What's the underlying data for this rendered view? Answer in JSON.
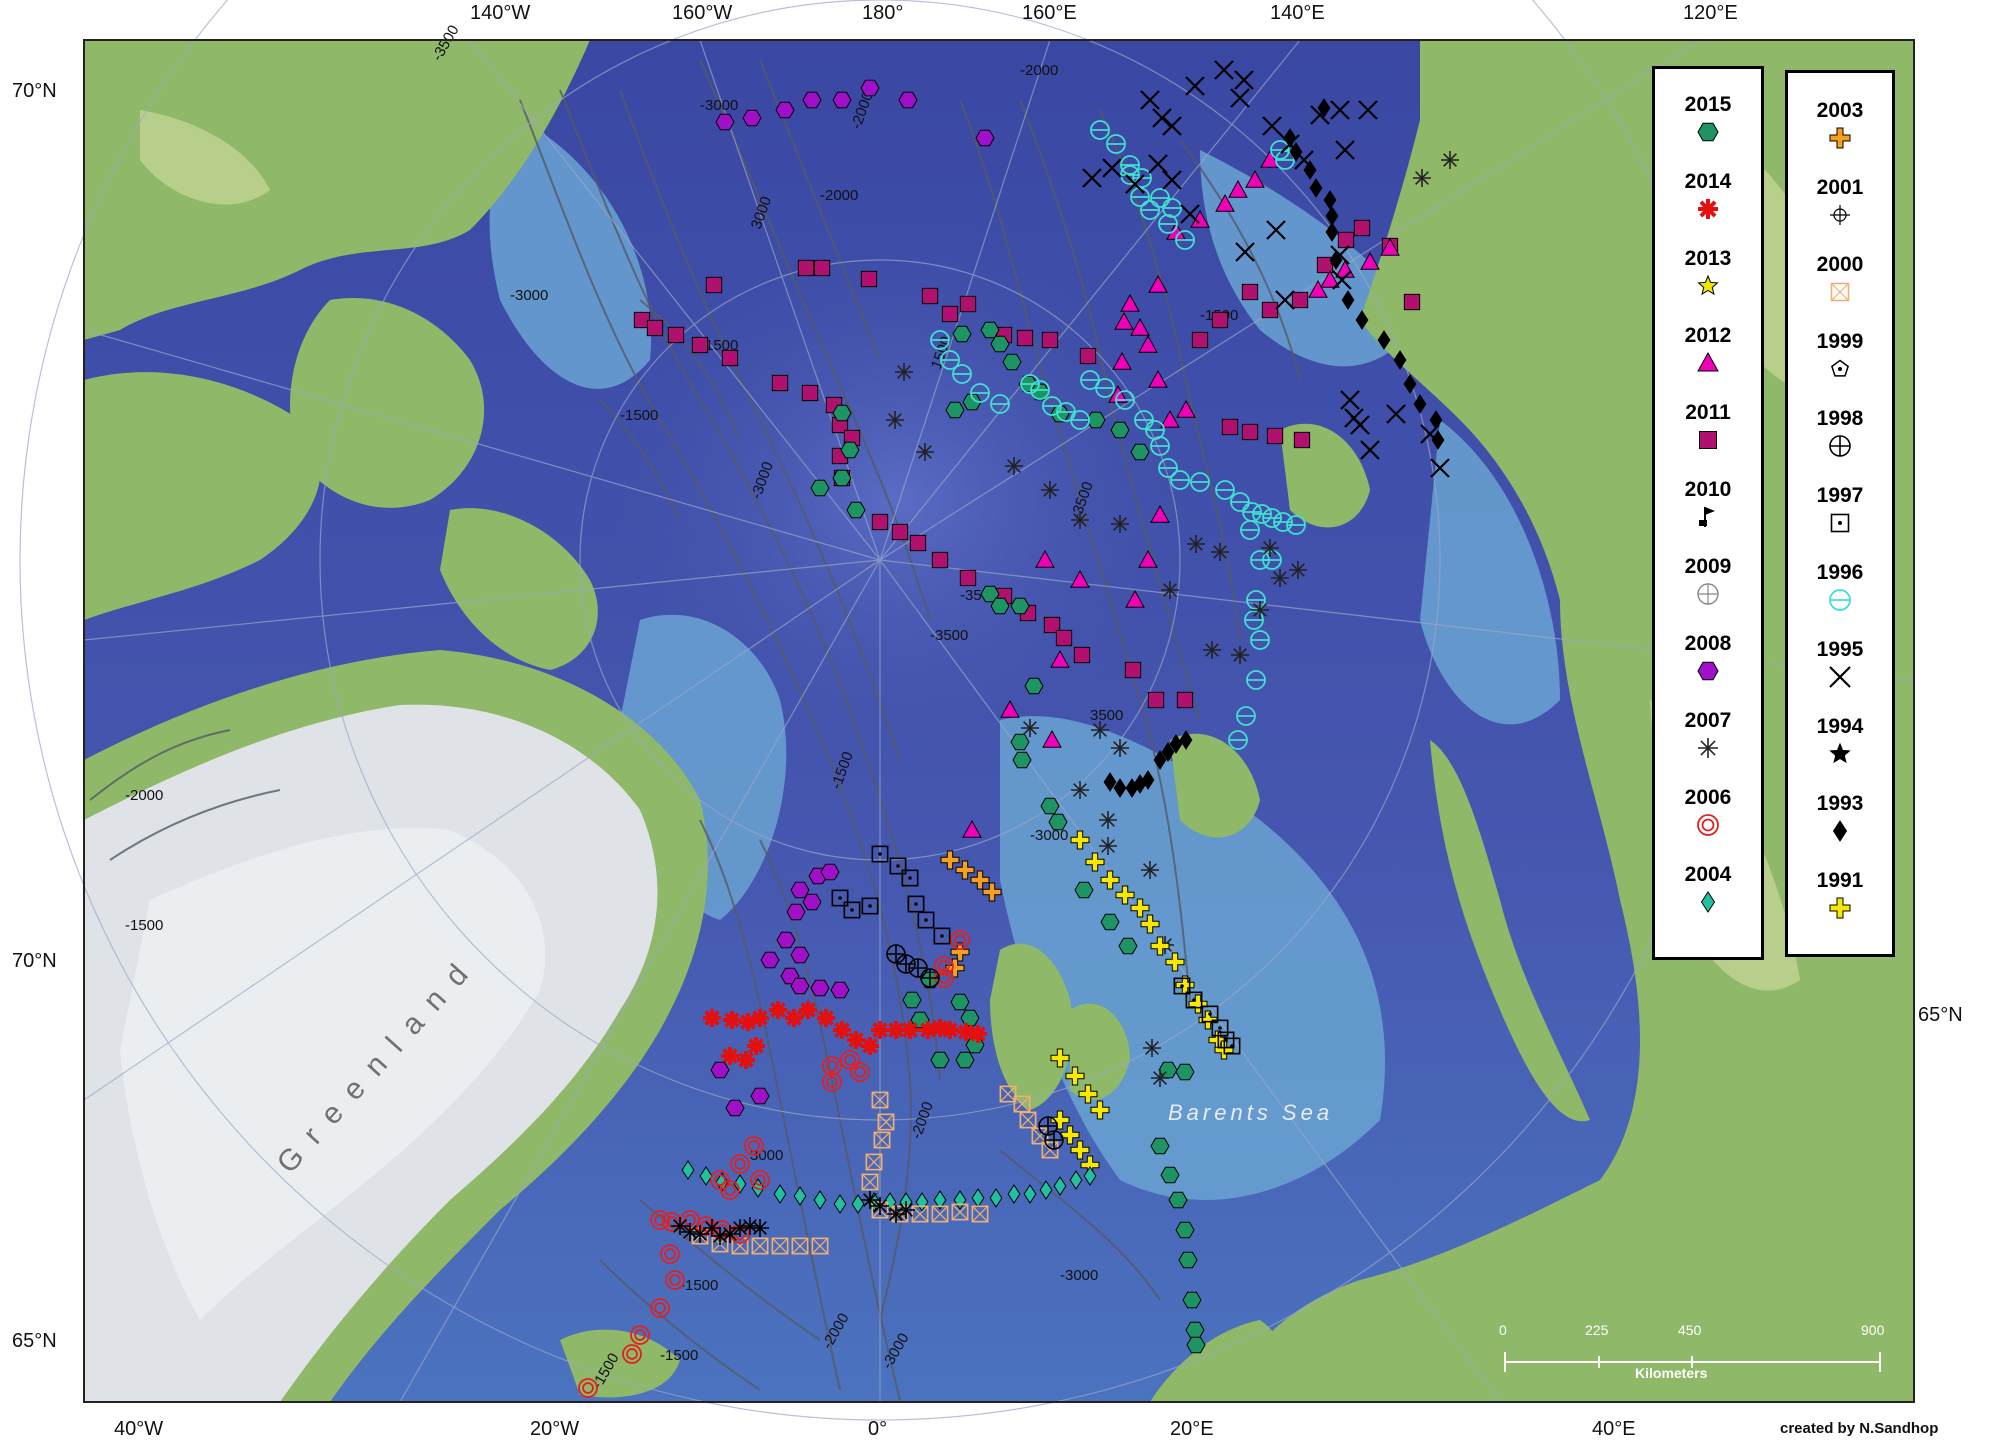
{
  "map": {
    "place_labels": {
      "greenland": "Greenland",
      "barents_sea": "Barents Sea"
    },
    "colors": {
      "ocean_deep": "#3f4ea6",
      "ocean_mid": "#4a6ec0",
      "shelf": "#6aa3d2",
      "land": "#8fb868",
      "land_light": "#c9d99a",
      "ice": "#dfe3e8",
      "contour": "#555a66",
      "graticule": "#9ca6c8"
    }
  },
  "axes": {
    "top": [
      "140°W",
      "160°W",
      "180°",
      "160°E",
      "140°E",
      "120°E"
    ],
    "bottom": [
      "40°W",
      "20°W",
      "0°",
      "20°E",
      "40°E"
    ],
    "left": [
      "70°N",
      "70°N",
      "65°N"
    ],
    "right": [
      "65°N"
    ]
  },
  "contour_labels": [
    "-3500",
    "-2000",
    "-3000",
    "-2000",
    "-2000",
    "3000",
    "-3000",
    "-1500",
    "1500",
    "-1500",
    "-3000",
    "-3500",
    "-3500",
    "3500",
    "-3500",
    "-1500",
    "-2000",
    "-1500",
    "-1500",
    "-3000",
    "-1500",
    "-1500",
    "-1500",
    "-2000",
    "-3000",
    "3000",
    "-2000",
    "-3000"
  ],
  "legend": {
    "left": [
      {
        "year": "2015",
        "marker": "hexagon",
        "color": "#1e9464"
      },
      {
        "year": "2014",
        "marker": "star-burst",
        "color": "#e31010"
      },
      {
        "year": "2013",
        "marker": "star",
        "color": "#f2e600"
      },
      {
        "year": "2012",
        "marker": "triangle",
        "color": "#f000b8"
      },
      {
        "year": "2011",
        "marker": "square",
        "color": "#b0106e"
      },
      {
        "year": "2010",
        "marker": "flag",
        "color": "#000000"
      },
      {
        "year": "2009",
        "marker": "grid-circle",
        "color": "#888888"
      },
      {
        "year": "2008",
        "marker": "hexagon",
        "color": "#a010c8"
      },
      {
        "year": "2007",
        "marker": "asterisk",
        "color": "#222222"
      },
      {
        "year": "2006",
        "marker": "double-circle",
        "color": "#e32020"
      },
      {
        "year": "2004",
        "marker": "diamond",
        "color": "#22c0a0"
      }
    ],
    "right": [
      {
        "year": "2003",
        "marker": "plus",
        "color": "#f5a020"
      },
      {
        "year": "2001",
        "marker": "crosshair",
        "color": "#000000"
      },
      {
        "year": "2000",
        "marker": "box-x",
        "color": "#f0b070"
      },
      {
        "year": "1999",
        "marker": "pentagon",
        "color": "#000000"
      },
      {
        "year": "1998",
        "marker": "circle-plus",
        "color": "#000000"
      },
      {
        "year": "1997",
        "marker": "box-dot",
        "color": "#000000"
      },
      {
        "year": "1996",
        "marker": "circle-line",
        "color": "#40e0d0"
      },
      {
        "year": "1995",
        "marker": "x",
        "color": "#000000"
      },
      {
        "year": "1994",
        "marker": "star",
        "color": "#000000"
      },
      {
        "year": "1993",
        "marker": "diamond",
        "color": "#000000"
      },
      {
        "year": "1991",
        "marker": "plus",
        "color": "#f8e800"
      }
    ]
  },
  "scale_bar": {
    "ticks": [
      "0",
      "225",
      "450",
      "900"
    ],
    "unit": "Kilometers"
  },
  "credit": "created by N.Sandhop"
}
